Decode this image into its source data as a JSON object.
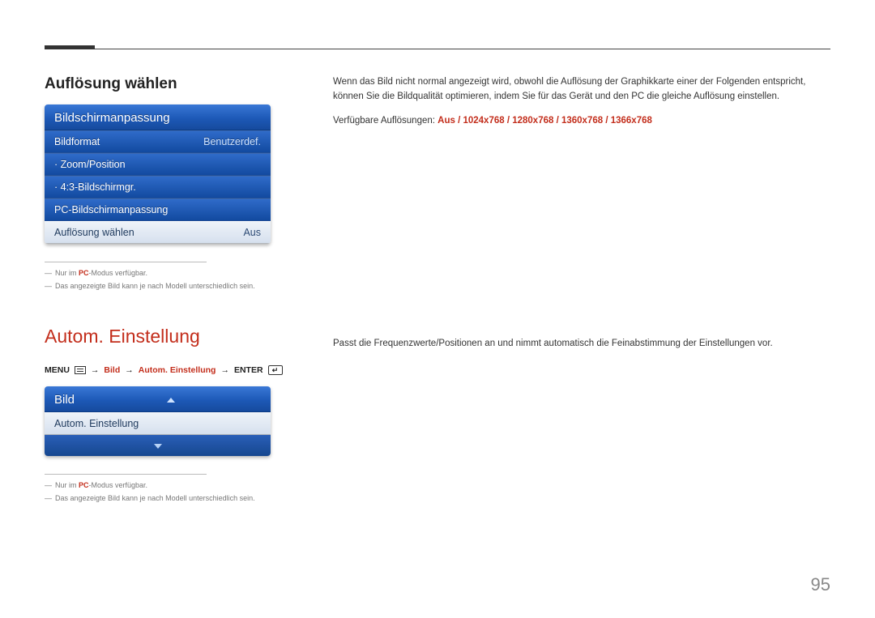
{
  "section1": {
    "title": "Auflösung wählen",
    "panel": {
      "header": "Bildschirmanpassung",
      "rows": [
        {
          "label": "Bildformat",
          "value": "Benutzerdef.",
          "light": false
        },
        {
          "label": "· Zoom/Position",
          "value": "",
          "light": false
        },
        {
          "label": "· 4:3-Bildschirmgr.",
          "value": "",
          "light": false
        },
        {
          "label": "PC-Bildschirmanpassung",
          "value": "",
          "light": false
        },
        {
          "label": "Auflösung wählen",
          "value": "Aus",
          "light": true
        }
      ]
    },
    "note1_pre": "Nur im ",
    "note1_pc": "PC",
    "note1_post": "-Modus verfügbar.",
    "note2": "Das angezeigte Bild kann je nach Modell unterschiedlich sein.",
    "right_p1": "Wenn das Bild nicht normal angezeigt wird, obwohl die Auflösung der Graphikkarte einer der Folgenden entspricht, können Sie die Bildqualität optimieren, indem Sie für das Gerät und den PC die gleiche Auflösung einstellen.",
    "right_res_label": "Verfügbare Auflösungen: ",
    "right_res_values": "Aus / 1024x768 / 1280x768 / 1360x768 / 1366x768"
  },
  "section2": {
    "heading": "Autom. Einstellung",
    "menu_label": "MENU",
    "bild": "Bild",
    "autoe": "Autom. Einstellung",
    "enter": "ENTER",
    "arrow": "→",
    "panel": {
      "header": "Bild",
      "row": "Autom. Einstellung"
    },
    "note1_pre": "Nur im ",
    "note1_pc": "PC",
    "note1_post": "-Modus verfügbar.",
    "note2": "Das angezeigte Bild kann je nach Modell unterschiedlich sein.",
    "right_p1": "Passt die Frequenzwerte/Positionen an und nimmt automatisch die Feinabstimmung der Einstellungen vor."
  },
  "page_number": "95"
}
